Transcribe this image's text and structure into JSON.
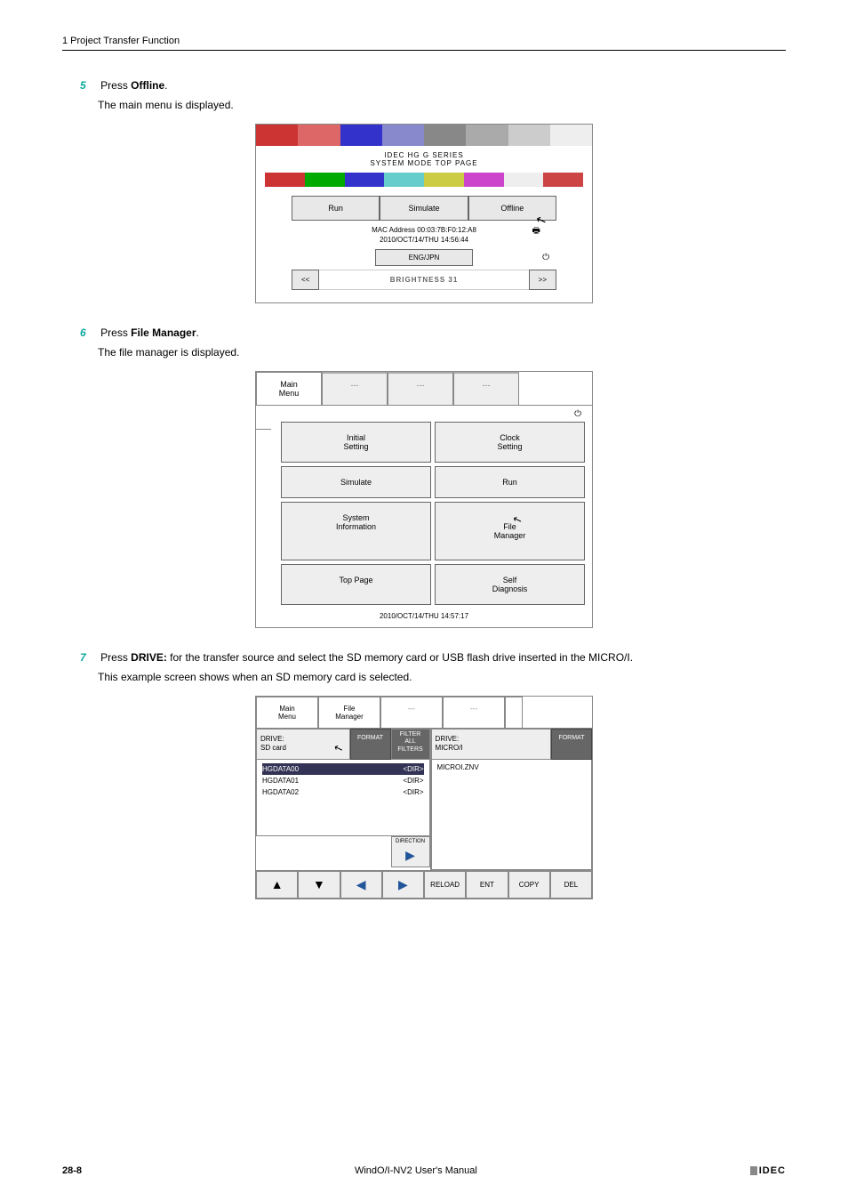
{
  "header": {
    "section": "1 Project Transfer Function"
  },
  "steps": {
    "s5": {
      "num": "5",
      "label_pre": "Press ",
      "label_bold": "Offline",
      "label_post": ".",
      "sub": "The main menu is displayed."
    },
    "s6": {
      "num": "6",
      "label_pre": "Press ",
      "label_bold": "File Manager",
      "label_post": ".",
      "sub": "The file manager is displayed."
    },
    "s7": {
      "num": "7",
      "label_pre": "Press ",
      "label_bold": "DRIVE:",
      "label_post": " for the transfer source and select the SD memory card or USB flash drive inserted in the MICRO/I.",
      "sub": "This example screen shows when an SD memory card is selected."
    }
  },
  "fig1": {
    "title1": "IDEC HG G SERIES",
    "title2": "SYSTEM MODE TOP PAGE",
    "buttons": {
      "run": "Run",
      "simulate": "Simulate",
      "offline": "Offline"
    },
    "mac": "MAC Address  00:03:7B:F0:12:A8",
    "datetime": "2010/OCT/14/THU   14:56:44",
    "engjpn": "ENG/JPN",
    "brightness": "BRIGHTNESS 31",
    "prev": "<<",
    "next": ">>",
    "cursor": "↖"
  },
  "fig2": {
    "tabs": {
      "main": "Main\nMenu",
      "dash": "---"
    },
    "cells": {
      "initial": "Initial\nSetting",
      "clock": "Clock\nSetting",
      "simulate": "Simulate",
      "run": "Run",
      "sysinfo": "System\nInformation",
      "filemgr": "File\nManager",
      "top": "Top Page",
      "self": "Self\nDiagnosis"
    },
    "datetime": "2010/OCT/14/THU  14:57:17",
    "cursor": "↖"
  },
  "fig3": {
    "tabs": {
      "main": "Main\nMenu",
      "file": "File\nManager",
      "dash": "---"
    },
    "left": {
      "drive_label": "DRIVE:",
      "drive_val": "SD  card",
      "format": "FORMAT",
      "list": [
        {
          "name": "HGDATA00",
          "type": "<DIR>",
          "sel": true
        },
        {
          "name": "HGDATA01",
          "type": "<DIR>",
          "sel": false
        },
        {
          "name": "HGDATA02",
          "type": "<DIR>",
          "sel": false
        }
      ]
    },
    "center": {
      "filter": "FILTER",
      "all": "ALL\nFILTERS",
      "direction": "DIRECTION",
      "arrow": "▶"
    },
    "right": {
      "drive_label": "DRIVE:",
      "drive_val": "MICRO/I",
      "format": "FORMAT",
      "file": "MICROI.ZNV"
    },
    "bottom": {
      "up": "▲",
      "down": "▼",
      "left": "◀",
      "right": "▶",
      "reload": "RELOAD",
      "ent": "ENT",
      "copy": "COPY",
      "del": "DEL"
    },
    "cursor": "↖"
  },
  "footer": {
    "page": "28-8",
    "center": "WindO/I-NV2 User's Manual",
    "logo": "IDEC"
  }
}
